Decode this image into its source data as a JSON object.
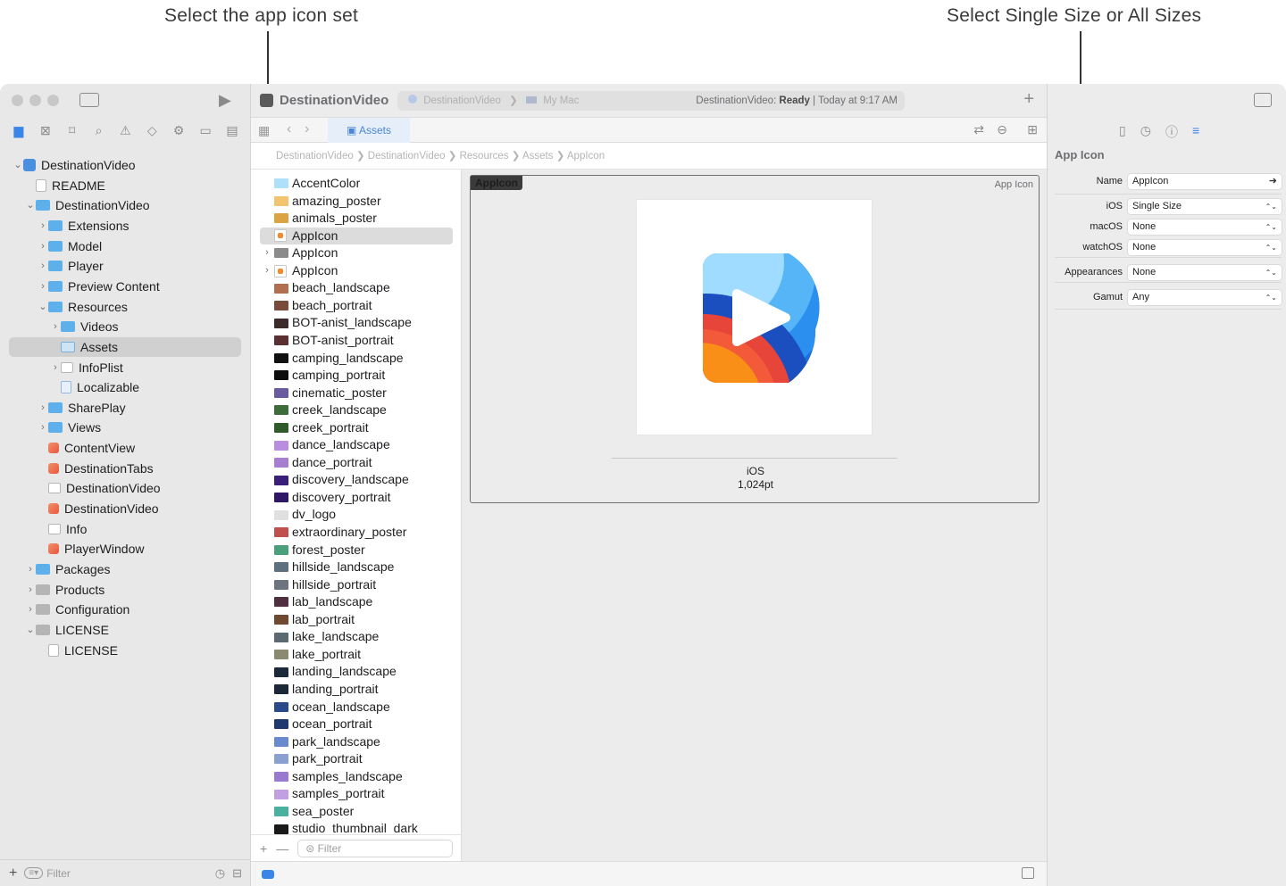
{
  "callouts": {
    "left": "Select the app icon set",
    "right": "Select Single Size or All Sizes"
  },
  "sidebar": {
    "tree": [
      {
        "label": "DestinationVideo",
        "icon": "project-icon",
        "depth": 0,
        "chevron": "down"
      },
      {
        "label": "README",
        "icon": "book-icon",
        "depth": 1,
        "chevron": ""
      },
      {
        "label": "DestinationVideo",
        "icon": "folder-icon",
        "depth": 1,
        "chevron": "down"
      },
      {
        "label": "Extensions",
        "icon": "folder-icon",
        "depth": 2,
        "chevron": "right"
      },
      {
        "label": "Model",
        "icon": "folder-icon",
        "depth": 2,
        "chevron": "right"
      },
      {
        "label": "Player",
        "icon": "folder-icon",
        "depth": 2,
        "chevron": "right"
      },
      {
        "label": "Preview Content",
        "icon": "folder-icon",
        "depth": 2,
        "chevron": "right"
      },
      {
        "label": "Resources",
        "icon": "folder-icon",
        "depth": 2,
        "chevron": "down"
      },
      {
        "label": "Videos",
        "icon": "folder-icon",
        "depth": 3,
        "chevron": "right"
      },
      {
        "label": "Assets",
        "icon": "asset-catalog-icon",
        "depth": 3,
        "chevron": "",
        "selected": true
      },
      {
        "label": "InfoPlist",
        "icon": "plist-icon",
        "depth": 3,
        "chevron": "right"
      },
      {
        "label": "Localizable",
        "icon": "strings-icon",
        "depth": 3,
        "chevron": ""
      },
      {
        "label": "SharePlay",
        "icon": "folder-icon",
        "depth": 2,
        "chevron": "right"
      },
      {
        "label": "Views",
        "icon": "folder-icon",
        "depth": 2,
        "chevron": "right"
      },
      {
        "label": "ContentView",
        "icon": "swift-icon",
        "depth": 2,
        "chevron": ""
      },
      {
        "label": "DestinationTabs",
        "icon": "swift-icon",
        "depth": 2,
        "chevron": ""
      },
      {
        "label": "DestinationVideo",
        "icon": "entitlements-icon",
        "depth": 2,
        "chevron": ""
      },
      {
        "label": "DestinationVideo",
        "icon": "swift-icon",
        "depth": 2,
        "chevron": ""
      },
      {
        "label": "Info",
        "icon": "table-icon",
        "depth": 2,
        "chevron": ""
      },
      {
        "label": "PlayerWindow",
        "icon": "swift-icon",
        "depth": 2,
        "chevron": ""
      },
      {
        "label": "Packages",
        "icon": "folder-icon",
        "depth": 1,
        "chevron": "right"
      },
      {
        "label": "Products",
        "icon": "grey-folder-icon",
        "depth": 1,
        "chevron": "right"
      },
      {
        "label": "Configuration",
        "icon": "grey-folder-icon",
        "depth": 1,
        "chevron": "right"
      },
      {
        "label": "LICENSE",
        "icon": "grey-folder-icon",
        "depth": 1,
        "chevron": "down"
      },
      {
        "label": "LICENSE",
        "icon": "doc-icon",
        "depth": 2,
        "chevron": ""
      }
    ],
    "filter_placeholder": "Filter"
  },
  "toolbar": {
    "title": "DestinationVideo",
    "scheme": "DestinationVideo",
    "destination": "My Mac",
    "status_app": "DestinationVideo:",
    "status_state": "Ready",
    "status_time": "| Today at 9:17 AM",
    "tab": "Assets"
  },
  "jumpbar": [
    "DestinationVideo",
    "DestinationVideo",
    "Resources",
    "Assets",
    "AppIcon"
  ],
  "asset_list": {
    "items": [
      {
        "label": "AccentColor",
        "thumb": "#aee0fb",
        "chevron": ""
      },
      {
        "label": "amazing_poster",
        "thumb": "#f2c46d",
        "chevron": ""
      },
      {
        "label": "animals_poster",
        "thumb": "#d9a441",
        "chevron": ""
      },
      {
        "label": "AppIcon",
        "thumb": "appicon",
        "chevron": "",
        "selected": true
      },
      {
        "label": "AppIcon",
        "thumb": "folder",
        "chevron": "right"
      },
      {
        "label": "AppIcon",
        "thumb": "appicon",
        "chevron": "right"
      },
      {
        "label": "beach_landscape",
        "thumb": "#b07050",
        "chevron": ""
      },
      {
        "label": "beach_portrait",
        "thumb": "#7a4a3a",
        "chevron": ""
      },
      {
        "label": "BOT-anist_landscape",
        "thumb": "#3d2b2b",
        "chevron": ""
      },
      {
        "label": "BOT-anist_portrait",
        "thumb": "#5a3030",
        "chevron": ""
      },
      {
        "label": "camping_landscape",
        "thumb": "#111111",
        "chevron": ""
      },
      {
        "label": "camping_portrait",
        "thumb": "#0d0d0d",
        "chevron": ""
      },
      {
        "label": "cinematic_poster",
        "thumb": "#6a5aa0",
        "chevron": ""
      },
      {
        "label": "creek_landscape",
        "thumb": "#3d6b3a",
        "chevron": ""
      },
      {
        "label": "creek_portrait",
        "thumb": "#2f5a2a",
        "chevron": ""
      },
      {
        "label": "dance_landscape",
        "thumb": "#b98ee0",
        "chevron": ""
      },
      {
        "label": "dance_portrait",
        "thumb": "#a77fd0",
        "chevron": ""
      },
      {
        "label": "discovery_landscape",
        "thumb": "#3a1f7a",
        "chevron": ""
      },
      {
        "label": "discovery_portrait",
        "thumb": "#2e1866",
        "chevron": ""
      },
      {
        "label": "dv_logo",
        "thumb": "#e0e0e0",
        "chevron": ""
      },
      {
        "label": "extraordinary_poster",
        "thumb": "#c0504d",
        "chevron": ""
      },
      {
        "label": "forest_poster",
        "thumb": "#4aa07a",
        "chevron": ""
      },
      {
        "label": "hillside_landscape",
        "thumb": "#5c7080",
        "chevron": ""
      },
      {
        "label": "hillside_portrait",
        "thumb": "#6c7480",
        "chevron": ""
      },
      {
        "label": "lab_landscape",
        "thumb": "#503040",
        "chevron": ""
      },
      {
        "label": "lab_portrait",
        "thumb": "#704a30",
        "chevron": ""
      },
      {
        "label": "lake_landscape",
        "thumb": "#5a6a70",
        "chevron": ""
      },
      {
        "label": "lake_portrait",
        "thumb": "#8a8a70",
        "chevron": ""
      },
      {
        "label": "landing_landscape",
        "thumb": "#1a2a3a",
        "chevron": ""
      },
      {
        "label": "landing_portrait",
        "thumb": "#1a2838",
        "chevron": ""
      },
      {
        "label": "ocean_landscape",
        "thumb": "#2a4a8a",
        "chevron": ""
      },
      {
        "label": "ocean_portrait",
        "thumb": "#203a70",
        "chevron": ""
      },
      {
        "label": "park_landscape",
        "thumb": "#6a8ad0",
        "chevron": ""
      },
      {
        "label": "park_portrait",
        "thumb": "#8aa0d0",
        "chevron": ""
      },
      {
        "label": "samples_landscape",
        "thumb": "#9a7ad0",
        "chevron": ""
      },
      {
        "label": "samples_portrait",
        "thumb": "#c0a0e0",
        "chevron": ""
      },
      {
        "label": "sea_poster",
        "thumb": "#4ab0a0",
        "chevron": ""
      },
      {
        "label": "studio_thumbnail_dark",
        "thumb": "#1a1a1a",
        "chevron": ""
      }
    ],
    "filter_placeholder": "Filter"
  },
  "editor": {
    "panel_tag": "AppIcon",
    "panel_kind": "App Icon",
    "platform": "iOS",
    "size": "1,024pt"
  },
  "inspector": {
    "title": "App Icon",
    "name_label": "Name",
    "name_value": "AppIcon",
    "rows": [
      {
        "label": "iOS",
        "value": "Single Size"
      },
      {
        "label": "macOS",
        "value": "None"
      },
      {
        "label": "watchOS",
        "value": "None"
      },
      {
        "label": "Appearances",
        "value": "None"
      },
      {
        "label": "Gamut",
        "value": "Any"
      }
    ]
  },
  "colors": {
    "accent": "#3a86e8",
    "folder": "#5db0ea",
    "selection": "#d0d0d0"
  }
}
